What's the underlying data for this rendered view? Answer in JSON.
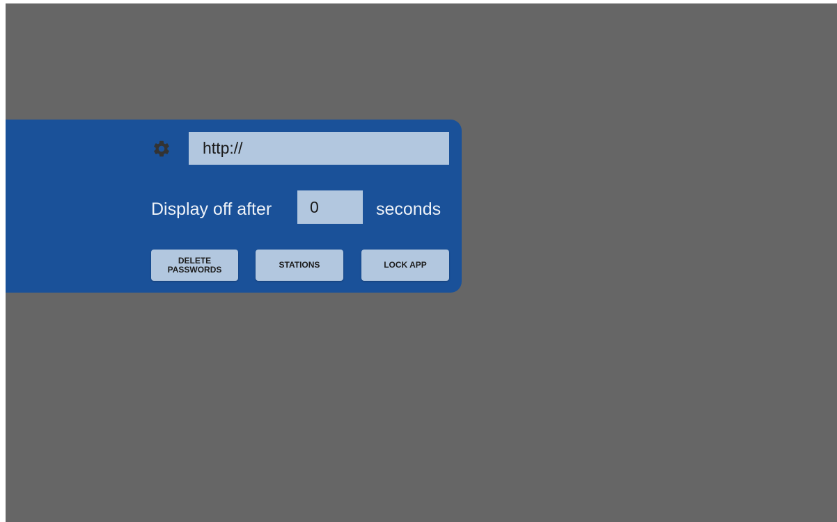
{
  "colors": {
    "background": "#666666",
    "panel": "#1a5199",
    "field": "#b2c7df",
    "gear": "#333333"
  },
  "settings": {
    "gear_icon": "gear-icon",
    "url_value": "http://",
    "display_off_label": "Display off after",
    "seconds_value": "0",
    "seconds_label": "seconds"
  },
  "buttons": {
    "delete_passwords": "DELETE\nPASSWORDS",
    "stations": "STATIONS",
    "lock_app": "LOCK APP"
  }
}
